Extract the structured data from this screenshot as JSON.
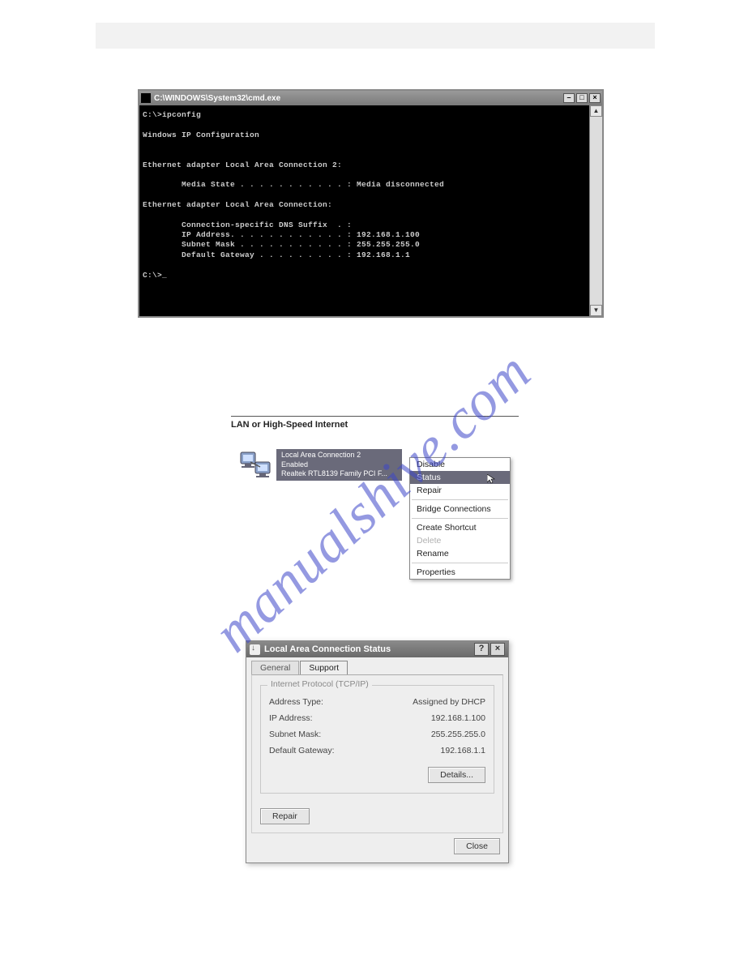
{
  "watermark": "manualshive.com",
  "cmd": {
    "title": "C:\\WINDOWS\\System32\\cmd.exe",
    "lines": [
      "C:\\>ipconfig",
      "",
      "Windows IP Configuration",
      "",
      "",
      "Ethernet adapter Local Area Connection 2:",
      "",
      "        Media State . . . . . . . . . . . : Media disconnected",
      "",
      "Ethernet adapter Local Area Connection:",
      "",
      "        Connection-specific DNS Suffix  . :",
      "        IP Address. . . . . . . . . . . . : 192.168.1.100",
      "        Subnet Mask . . . . . . . . . . . : 255.255.255.0",
      "        Default Gateway . . . . . . . . . : 192.168.1.1",
      "",
      "C:\\>_"
    ]
  },
  "lan": {
    "heading": "LAN or High-Speed Internet",
    "item": {
      "name": "Local Area Connection 2",
      "status": "Enabled",
      "device": "Realtek RTL8139 Family PCI F..."
    },
    "menu": {
      "disable": "Disable",
      "status": "Status",
      "repair": "Repair",
      "bridge": "Bridge Connections",
      "shortcut": "Create Shortcut",
      "delete": "Delete",
      "rename": "Rename",
      "properties": "Properties"
    }
  },
  "dlg": {
    "title": "Local Area Connection Status",
    "tabs": {
      "general": "General",
      "support": "Support"
    },
    "group_title": "Internet Protocol (TCP/IP)",
    "rows": {
      "addr_type_l": "Address Type:",
      "addr_type_v": "Assigned by DHCP",
      "ip_l": "IP Address:",
      "ip_v": "192.168.1.100",
      "mask_l": "Subnet Mask:",
      "mask_v": "255.255.255.0",
      "gw_l": "Default Gateway:",
      "gw_v": "192.168.1.1"
    },
    "details_btn": "Details...",
    "repair_btn": "Repair",
    "close_btn": "Close"
  }
}
